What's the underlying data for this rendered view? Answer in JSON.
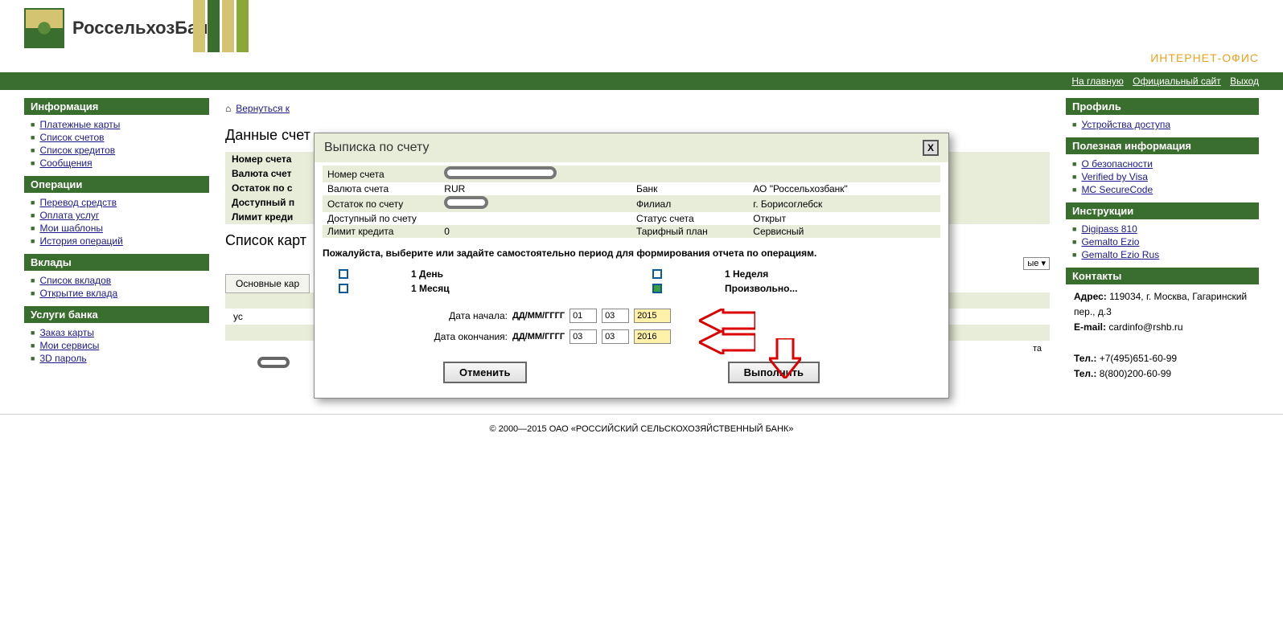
{
  "brand": {
    "main": "РоссельхозБанк",
    "sub": "ИНТЕРНЕТ-ОФИС"
  },
  "topnav": {
    "home": "На главную",
    "site": "Официальный сайт",
    "exit": "Выход"
  },
  "sidebar": {
    "info": {
      "title": "Информация",
      "items": [
        "Платежные карты",
        "Список счетов",
        "Список кредитов",
        "Сообщения"
      ]
    },
    "ops": {
      "title": "Операции",
      "items": [
        "Перевод средств",
        "Оплата услуг",
        "Мои шаблоны",
        "История операций"
      ]
    },
    "deps": {
      "title": "Вклады",
      "items": [
        "Список вкладов",
        "Открытие вклада"
      ]
    },
    "svc": {
      "title": "Услуги банка",
      "items": [
        "Заказ карты",
        "Мои сервисы",
        "3D пароль"
      ]
    }
  },
  "rightbar": {
    "profile": {
      "title": "Профиль",
      "items": [
        "Устройства доступа"
      ]
    },
    "useful": {
      "title": "Полезная информация",
      "items": [
        "О безопасности",
        "Verified by Visa",
        "MC SecureCode"
      ]
    },
    "instr": {
      "title": "Инструкции",
      "items": [
        "Digipass 810",
        "Gemalto Ezio",
        "Gemalto Ezio Rus"
      ]
    },
    "contacts": {
      "title": "Контакты",
      "addr_label": "Адрес:",
      "addr": "119034, г. Москва, Гагаринский пер., д.3",
      "email_label": "E-mail:",
      "email": "cardinfo@rshb.ru",
      "tel_label": "Тел.:",
      "tel1": "+7(495)651-60-99",
      "tel2": "8(800)200-60-99"
    }
  },
  "main": {
    "breadcrumb": "Вернуться к",
    "title_data": "Данные счет",
    "title_cards": "Список карт",
    "tab": "Основные кар",
    "bg_labels": [
      "Номер счета",
      "Валюта счет",
      "Остаток по с",
      "Доступный п",
      "Лимит креди"
    ],
    "filter_opt": "ые  ▾"
  },
  "modal": {
    "title": "Выписка по счету",
    "rows": {
      "num": "Номер счета",
      "cur": "Валюта счета",
      "cur_v": "RUR",
      "bal": "Остаток по счету",
      "avail": "Доступный по счету",
      "limit": "Лимит кредита",
      "limit_v": "0",
      "bank": "Банк",
      "bank_v": "АО \"Россельхозбанк\"",
      "branch": "Филиал",
      "branch_v": "г. Борисоглебск",
      "status": "Статус счета",
      "status_v": "Открыт",
      "tariff": "Тарифный план",
      "tariff_v": "Сервисный"
    },
    "prompt": "Пожалуйста, выберите или задайте самостоятельно период для формирования отчета по операциям.",
    "periods": {
      "day": "1 День",
      "week": "1 Неделя",
      "month": "1 Месяц",
      "custom": "Произвольно..."
    },
    "date_start": "Дата начала:",
    "date_end": "Дата окончания:",
    "date_fmt": "ДД/ММ/ГГГГ",
    "start": {
      "d": "01",
      "m": "03",
      "y": "2015"
    },
    "end": {
      "d": "03",
      "m": "03",
      "y": "2016"
    },
    "cancel": "Отменить",
    "submit": "Выполнить"
  },
  "footer": "© 2000—2015 ОАО «РОССИЙСКИЙ СЕЛЬСКОХОЗЯЙСТВЕННЫЙ БАНК»"
}
